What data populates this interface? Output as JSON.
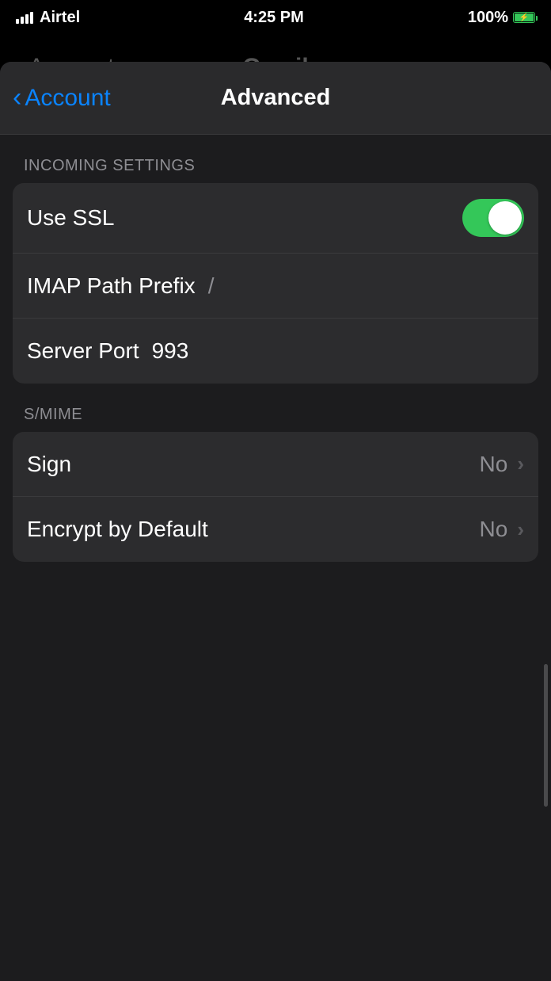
{
  "status": {
    "carrier": "Airtel",
    "time": "4:25 PM",
    "battery_percent": "100%"
  },
  "underlay": {
    "back": "Accounts",
    "title": "Gmail"
  },
  "nav": {
    "back_label": "Account",
    "title": "Advanced"
  },
  "sections": {
    "incoming": {
      "header": "Incoming Settings",
      "use_ssl_label": "Use SSL",
      "use_ssl_on": true,
      "imap_prefix_label": "IMAP Path Prefix",
      "imap_prefix_value": "/",
      "server_port_label": "Server Port",
      "server_port_value": "993"
    },
    "smime": {
      "header": "S/MIME",
      "sign_label": "Sign",
      "sign_value": "No",
      "encrypt_label": "Encrypt by Default",
      "encrypt_value": "No"
    }
  }
}
